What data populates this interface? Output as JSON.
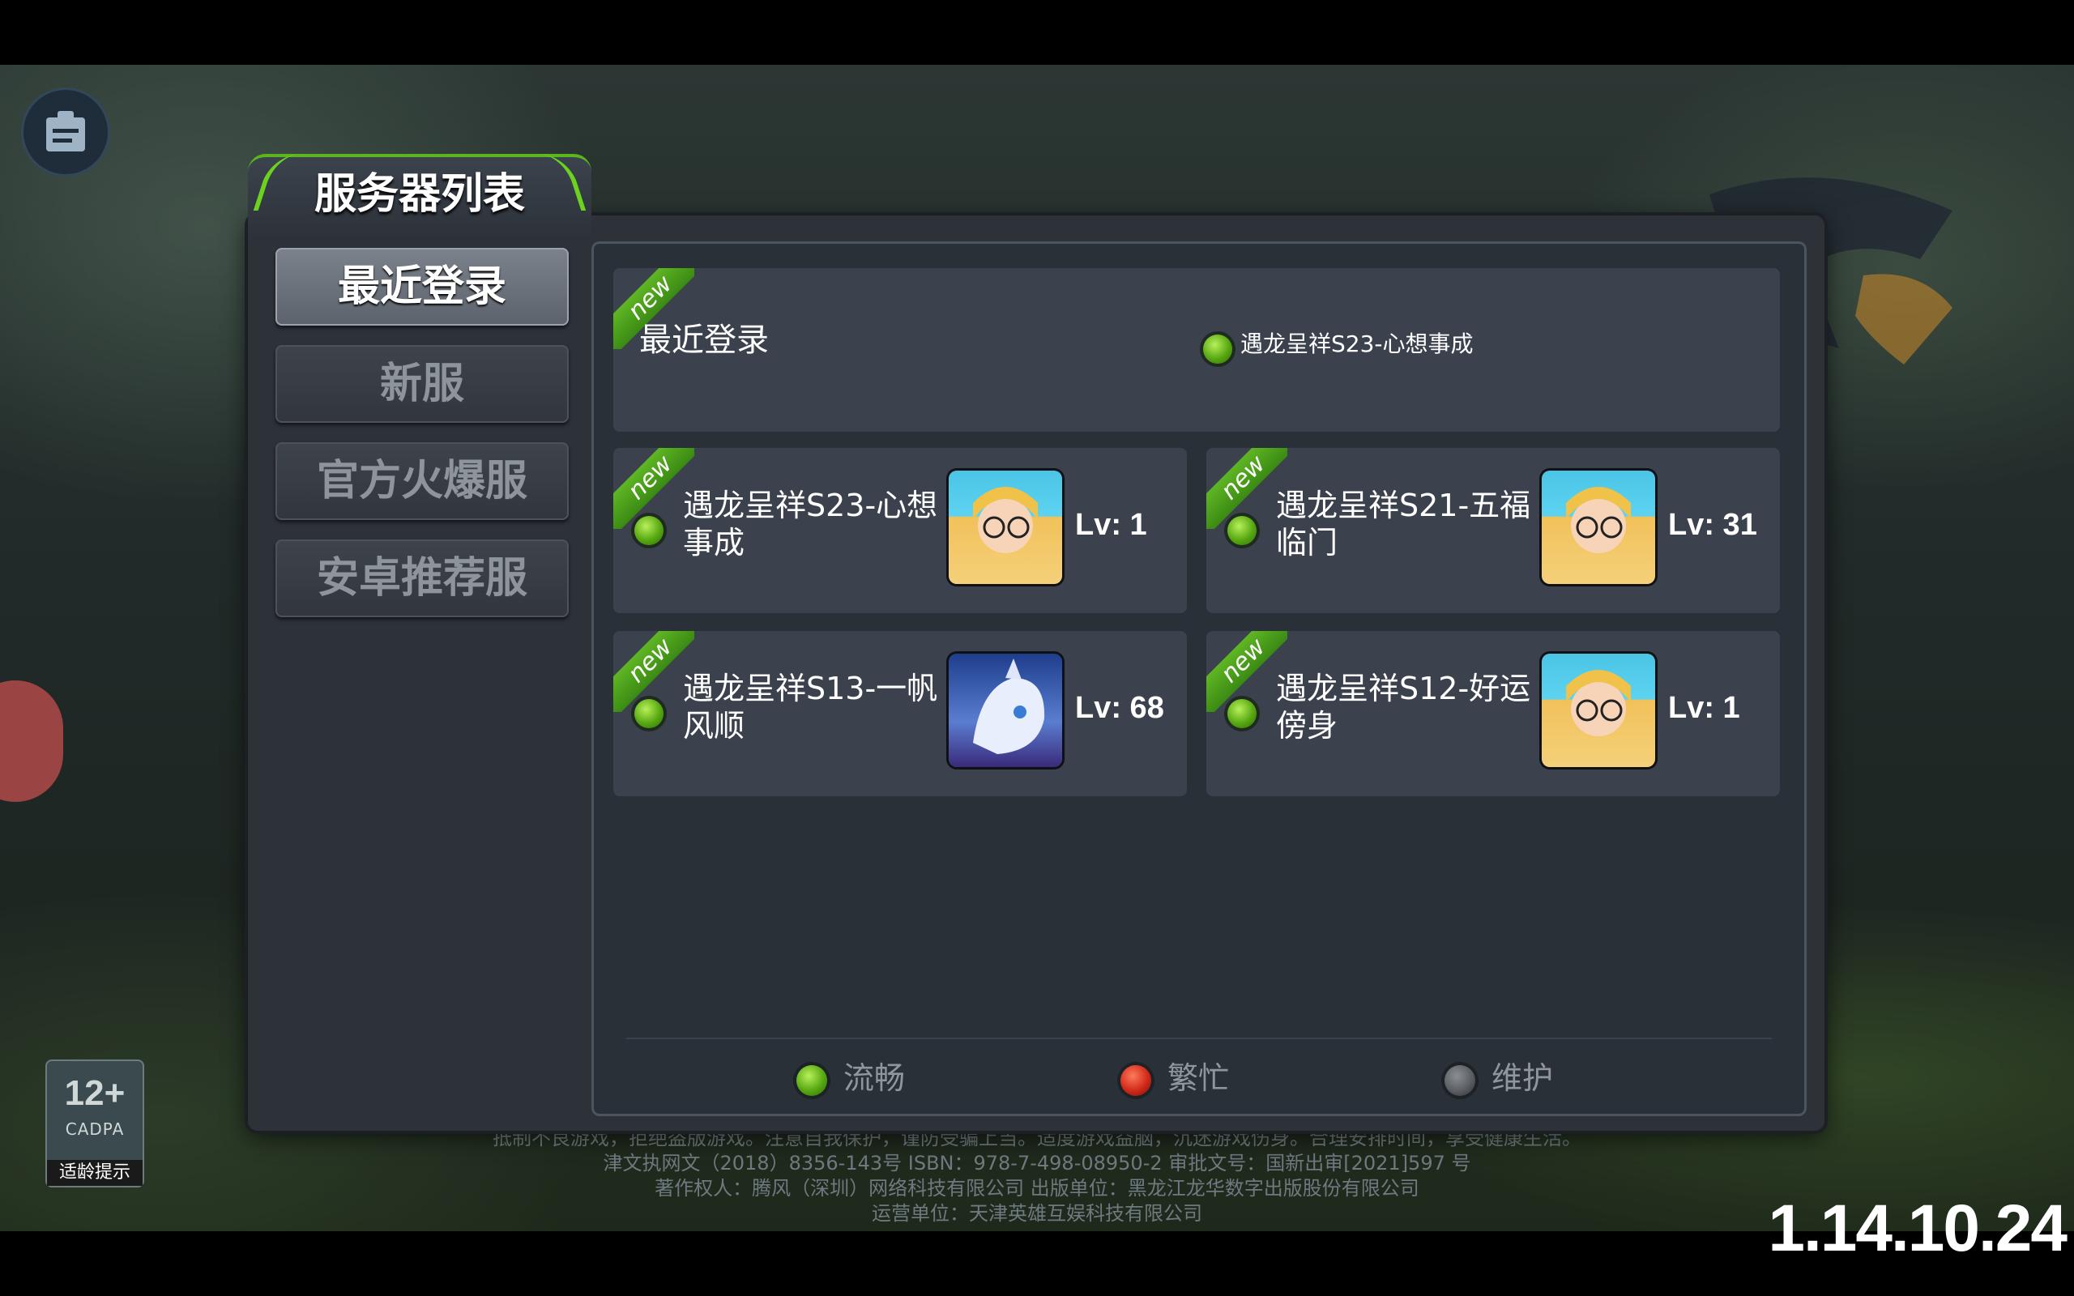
{
  "title": "服务器列表",
  "categories": [
    {
      "label": "最近登录",
      "active": true
    },
    {
      "label": "新服",
      "active": false
    },
    {
      "label": "官方火爆服",
      "active": false
    },
    {
      "label": "安卓推荐服",
      "active": false
    }
  ],
  "recent": {
    "badge": "new",
    "label": "最近登录",
    "server": "遇龙呈祥S23-心想事成"
  },
  "servers": [
    {
      "badge": "new",
      "name": "遇龙呈祥S23-心想事成",
      "level": "Lv: 1",
      "avatar": "elf-girl-avatar"
    },
    {
      "badge": "new",
      "name": "遇龙呈祥S21-五福临门",
      "level": "Lv: 31",
      "avatar": "elf-girl-avatar"
    },
    {
      "badge": "new",
      "name": "遇龙呈祥S13-一帆风顺",
      "level": "Lv: 68",
      "avatar": "white-dragon-avatar"
    },
    {
      "badge": "new",
      "name": "遇龙呈祥S12-好运傍身",
      "level": "Lv: 1",
      "avatar": "elf-girl-avatar"
    }
  ],
  "legend": [
    {
      "label": "流畅",
      "color": "#5fb624"
    },
    {
      "label": "繁忙",
      "color": "#d02a1a"
    },
    {
      "label": "维护",
      "color": "#5b5f63"
    }
  ],
  "age_rating": {
    "age": "12+",
    "org": "CADPA",
    "label": "适龄提示"
  },
  "legal_lines": [
    "抵制不良游戏，拒绝盗版游戏。注意自我保护，谨防受骗上当。适度游戏益脑，沉迷游戏伤身。合理安排时间，享受健康生活。",
    "津文执网文（2018）8356-143号 ISBN：978-7-498-08950-2 审批文号：国新出审[2021]597 号",
    "著作权人：腾风（深圳）网络科技有限公司 出版单位：黑龙江龙华数字出版股份有限公司",
    "运营单位：天津英雄互娱科技有限公司"
  ],
  "version": "1.14.10.24"
}
